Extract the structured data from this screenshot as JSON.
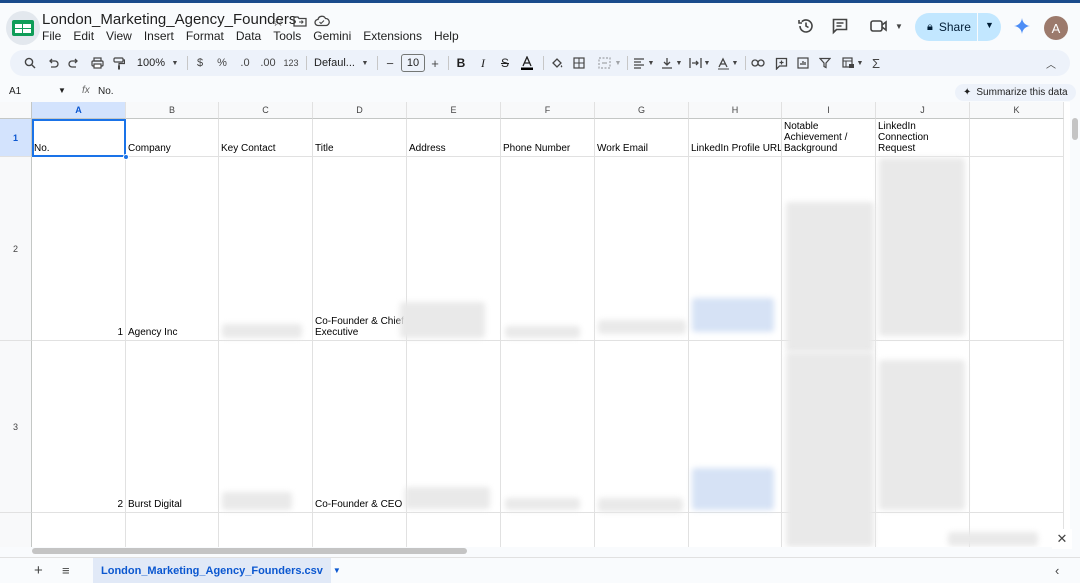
{
  "document": {
    "title": "London_Marketing_Agency_Founders",
    "star_icon": "star-icon",
    "move_icon": "folder-move-icon",
    "cloud_icon": "cloud-saved-icon"
  },
  "menu": [
    "File",
    "Edit",
    "View",
    "Insert",
    "Format",
    "Data",
    "Tools",
    "Gemini",
    "Extensions",
    "Help"
  ],
  "header_right": {
    "share_label": "Share",
    "avatar_letter": "A"
  },
  "toolbar": {
    "zoom": "100%",
    "currency": "$",
    "percent": "%",
    "decrease_decimal": ".0",
    "increase_decimal": ".00",
    "number_format": "123",
    "font": "Defaul...",
    "font_size": "10"
  },
  "formula_bar": {
    "cell_ref": "A1",
    "fx": "fx",
    "value": "No.",
    "summarize_label": "Summarize this data"
  },
  "columns": [
    "A",
    "B",
    "C",
    "D",
    "E",
    "F",
    "G",
    "H",
    "I",
    "J",
    "K"
  ],
  "rows": [
    {
      "label": "1",
      "cells": {
        "A": "No.",
        "B": "Company",
        "C": "Key Contact",
        "D": "Title",
        "E": "Address",
        "F": "Phone Number",
        "G": "Work Email",
        "H": "LinkedIn Profile URL",
        "I": "Notable Achievement / Background",
        "J": "Personalised LinkedIn Connection Request"
      }
    },
    {
      "label": "2",
      "cells": {
        "A": "1",
        "B": "Agency Inc",
        "D": "Co-Founder & Chief Executive"
      }
    },
    {
      "label": "3",
      "cells": {
        "A": "2",
        "B": "Burst Digital",
        "D": "Co-Founder & CEO"
      }
    },
    {
      "label": "",
      "cells": {}
    }
  ],
  "sheet": {
    "tab_name": "London_Marketing_Agency_Founders.csv"
  }
}
